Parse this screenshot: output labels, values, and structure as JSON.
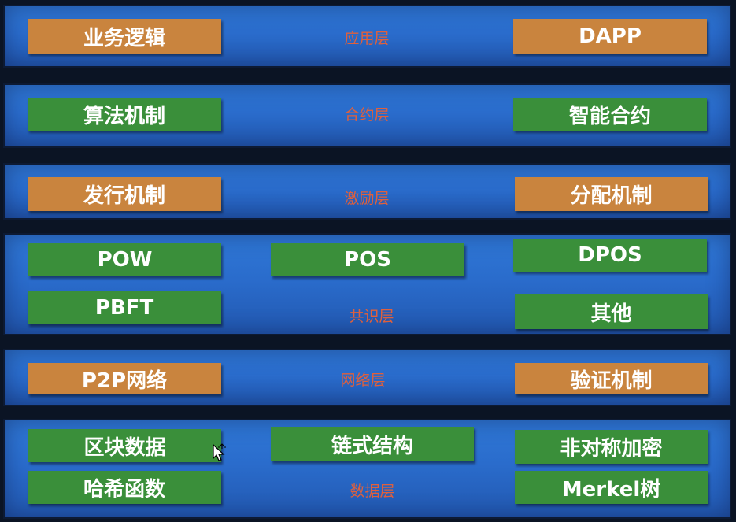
{
  "layers": [
    {
      "label": "应用层",
      "boxes": [
        "业务逻辑",
        "DAPP"
      ]
    },
    {
      "label": "合约层",
      "boxes": [
        "算法机制",
        "智能合约"
      ]
    },
    {
      "label": "激励层",
      "boxes": [
        "发行机制",
        "分配机制"
      ]
    },
    {
      "label": "共识层",
      "boxes": [
        "POW",
        "POS",
        "DPOS",
        "PBFT",
        "其他"
      ]
    },
    {
      "label": "网络层",
      "boxes": [
        "P2P网络",
        "验证机制"
      ]
    },
    {
      "label": "数据层",
      "boxes": [
        "区块数据",
        "链式结构",
        "非对称加密",
        "哈希函数",
        "Merkel树"
      ]
    }
  ],
  "colors": {
    "orange": "#c9843e",
    "green": "#3a8f3a",
    "label": "#e0603c",
    "layer": "#2a6ccc"
  },
  "icons": {
    "cursor": "move-cursor-icon"
  }
}
